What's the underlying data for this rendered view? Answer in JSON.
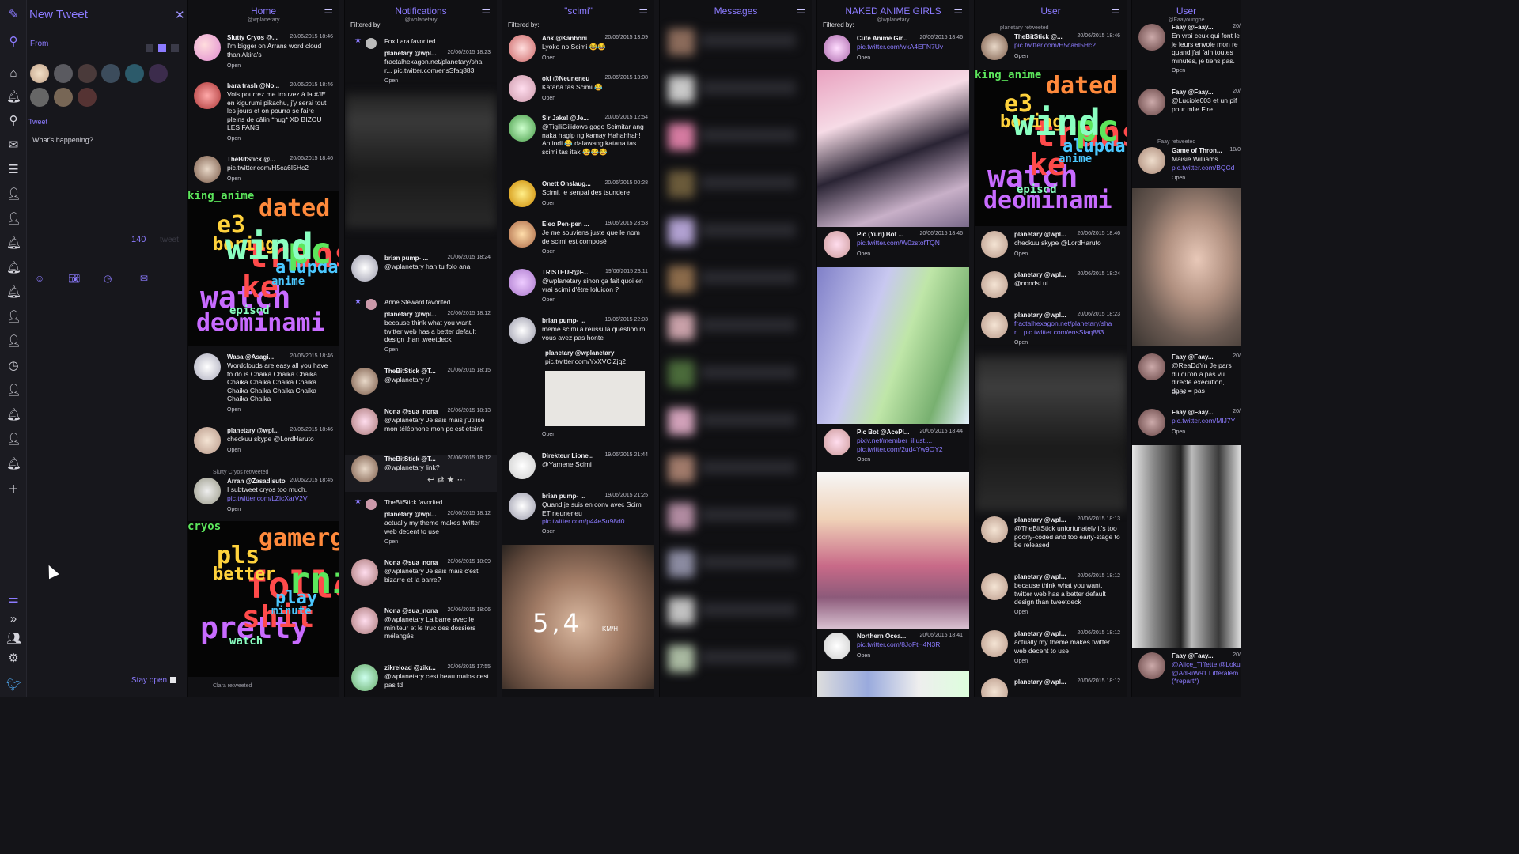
{
  "compose": {
    "title": "New Tweet",
    "from_label": "From",
    "tweet_label": "Tweet",
    "placeholder": "What's happening?",
    "char_count": "140",
    "char_label": "tweet",
    "stay_open": "Stay open"
  },
  "columns": [
    {
      "id": "home",
      "title": "Home",
      "subtitle": "@wplanetary"
    },
    {
      "id": "notifications",
      "title": "Notifications",
      "filter": "Filtered by:",
      "subtitle": "@wplanetary"
    },
    {
      "id": "scimi",
      "title": "\"scimi\"",
      "filter": "Filtered by:",
      "subtitle": "@wplanetary"
    },
    {
      "id": "messages",
      "title": "Messages"
    },
    {
      "id": "naked",
      "title": "NAKED ANIME GIRLS",
      "filter": "Filtered by:",
      "subtitle": "@wplanetary"
    },
    {
      "id": "user1",
      "title": "User",
      "subtitle": "@wplanetary"
    },
    {
      "id": "user2",
      "title": "User",
      "subtitle": "@Faayounghe"
    }
  ],
  "home": [
    {
      "name": "Slutty Cryos @...",
      "time": "20/06/2015 18:46",
      "text": "I'm bigger on Arrans word cloud than Akira's",
      "open": "Open"
    },
    {
      "name": "bara trash @No...",
      "time": "20/06/2015 18:46",
      "text": "Vois pourrez me trouvez à la #JE en kigurumi pikachu, j'y serai tout les jours et on pourra se faire pleins de câlin *hug* XD BIZOU LES FANS",
      "open": "Open"
    },
    {
      "name": "TheBitStick @...",
      "time": "20/06/2015 18:46",
      "text": "pic.twitter.com/H5ca6I5Hc2",
      "open": "Open"
    },
    {
      "name": "Wasa @Asagi...",
      "time": "20/06/2015 18:46",
      "text": "Wordclouds are easy all you have to do is Chaika Chaika Chaika Chaika Chaika Chaika Chaika Chaika Chaika Chaika Chaika Chaika Chaika",
      "open": "Open"
    },
    {
      "name": "planetary @wpl...",
      "time": "20/06/2015 18:46",
      "text": "checkuu skype @LordHaruto",
      "open": "Open"
    },
    {
      "retweet": "Slutty Cryos retweeted",
      "name": "Arran @Zasadisuto",
      "time": "20/06/2015 18:45",
      "text": "I subtweet cryos too much.",
      "link": "pic.twitter.com/LZicXarV2V",
      "open": "Open"
    },
    {
      "retweet": "Clara retweeted"
    }
  ],
  "notifications": [
    {
      "fav": "Fox Lara favorited",
      "name": "planetary @wpl...",
      "time": "20/06/2015 18:23",
      "text": "fractalhexagon.net/planetary/sha r... pic.twitter.com/ensSfaq883",
      "open": "Open"
    },
    {
      "name": "brian pump- ...",
      "time": "20/06/2015 18:24",
      "text": "@wplanetary han tu folo ana"
    },
    {
      "fav": "Anne Steward favorited",
      "name": "planetary @wpl...",
      "time": "20/06/2015 18:12",
      "text": "because think what you want, twitter web has a better default design than tweetdeck",
      "open": "Open"
    },
    {
      "name": "TheBitStick @T...",
      "time": "20/06/2015 18:15",
      "text": "@wplanetary :/"
    },
    {
      "name": "Nona @sua_nona",
      "time": "20/06/2015 18:13",
      "text": "@wplanetary Je sais mais j'utilise mon téléphone mon pc est eteint"
    },
    {
      "name": "TheBitStick @T...",
      "time": "20/06/2015 18:12",
      "text": "@wplanetary link?"
    },
    {
      "fav": "TheBitStick favorited",
      "name": "planetary @wpl...",
      "time": "20/06/2015 18:12",
      "text": "actually my theme makes twitter web decent to use",
      "open": "Open"
    },
    {
      "name": "Nona @sua_nona",
      "time": "20/06/2015 18:09",
      "text": "@wplanetary Je sais mais c'est bizarre et la barre?"
    },
    {
      "name": "Nona @sua_nona",
      "time": "20/06/2015 18:06",
      "text": "@wplanetary La barre avec le miniteur et le truc des dossiers mélangés"
    },
    {
      "name": "zikreload @zikr...",
      "time": "20/06/2015 17:55",
      "text": "@wplanetary cest beau maios cest pas td"
    }
  ],
  "scimi": [
    {
      "name": "Ank @Kanboni",
      "time": "20/06/2015 13:09",
      "text": "Lyoko no Scimi 😂😂",
      "open": "Open"
    },
    {
      "name": "oki @Neuneneu",
      "time": "20/06/2015 13:08",
      "text": "Katana tas Scimi 😂",
      "open": "Open"
    },
    {
      "name": "Sir Jake! @Je...",
      "time": "20/06/2015 12:54",
      "text": "@TigiliGilidows gago Scimitar ang naka hagip ng kamay Hahahhah! Antindi 😂 dalawang katana tas scimi tas itak 😂😂😂"
    },
    {
      "name": "Onett Onslaug...",
      "time": "20/06/2015 00:28",
      "text": "Scimi, le senpai des tsundere",
      "open": "Open"
    },
    {
      "name": "Eleo Pen-pen ...",
      "time": "19/06/2015 23:53",
      "text": "Je me souviens juste que le nom de scimi est composé",
      "open": "Open"
    },
    {
      "name": "TRISTEUR@F...",
      "time": "19/06/2015 23:11",
      "text": "@wplanetary sinon ça fait quoi en vrai scimi d'être loluicon ?",
      "open": "Open"
    },
    {
      "name": "brian pump- ...",
      "time": "19/06/2015 22:03",
      "text": "meme scimi a reussi la question m vous avez pas honte"
    },
    {
      "name": "planetary @wplanetary",
      "text": "pic.twitter.com/YxXVClZjq2",
      "open": "Open"
    },
    {
      "name": "Direkteur Lione...",
      "time": "19/06/2015 21:44",
      "text": "@Yamene Scimi"
    },
    {
      "name": "brian pump- ...",
      "time": "19/06/2015 21:25",
      "text": "Quand je suis en conv avec Scimi ET neuneneu",
      "link": "pic.twitter.com/p44eSu98d0",
      "open": "Open"
    },
    {
      "speed": "5,4",
      "unit": "KM/H"
    }
  ],
  "naked": [
    {
      "name": "Cute Anime Gir...",
      "time": "20/06/2015 18:46",
      "text": "pic.twitter.com/wkA4EFN7Uv",
      "open": "Open"
    },
    {
      "name": "Pic (Yuri) Bot ...",
      "time": "20/06/2015 18:46",
      "text": "pic.twitter.com/W0zstofTQN",
      "open": "Open"
    },
    {
      "name": "Pic Bot @AcePi...",
      "time": "20/06/2015 18:44",
      "text": "pixiv.net/member_illust.... pic.twitter.com/2ud4Yw9OY2",
      "open": "Open"
    },
    {
      "name": "Northern Ocea...",
      "time": "20/06/2015 18:41",
      "text": "pic.twitter.com/8JoFtH4N3R",
      "open": "Open"
    }
  ],
  "user1": [
    {
      "retweet": "planetary retweeted",
      "name": "TheBitStick @...",
      "time": "20/06/2015 18:46",
      "text": "pic.twitter.com/H5ca6I5Hc2",
      "open": "Open"
    },
    {
      "name": "planetary @wpl...",
      "time": "20/06/2015 18:46",
      "text": "checkuu skype @LordHaruto",
      "open": "Open"
    },
    {
      "name": "planetary @wpl...",
      "time": "20/06/2015 18:24",
      "text": "@nondsl ui"
    },
    {
      "name": "planetary @wpl...",
      "time": "20/06/2015 18:23",
      "text": "fractalhexagon.net/planetary/sha r... pic.twitter.com/ensSfaq883",
      "open": "Open"
    },
    {
      "name": "planetary @wpl...",
      "time": "20/06/2015 18:13",
      "text": "@TheBitStick unfortunately it's too poorly-coded and too early-stage to be released"
    },
    {
      "name": "planetary @wpl...",
      "time": "20/06/2015 18:12",
      "text": "because think what you want, twitter web has a better default design than tweetdeck",
      "open": "Open"
    },
    {
      "name": "planetary @wpl...",
      "time": "20/06/2015 18:12",
      "text": "actually my theme makes twitter web decent to use",
      "open": "Open"
    },
    {
      "name": "planetary @wpl...",
      "time": "20/06/2015 18:12"
    }
  ],
  "user2": [
    {
      "name": "Faay @Faay...",
      "time": "20/",
      "text": "En vrai ceux qui font le je leurs envoie mon re quand j'ai fain toutes minutes, je tiens pas.",
      "open": "Open"
    },
    {
      "name": "Faay @Faay...",
      "time": "20/",
      "text": "@Luciole003 et un pif pour mlle Fire"
    },
    {
      "retweet": "Faay retweeted",
      "name": "Game of Thron...",
      "time": "18/0",
      "text": "Maisie Williams",
      "link": "pic.twitter.com/BQCd",
      "open": "Open"
    },
    {
      "name": "Faay @Faay...",
      "time": "20/",
      "text": "@ReaDdYn Je pars du qu'on a pas vu directe exécution, donc = pas",
      "open": "Open"
    },
    {
      "name": "Faay @Faay...",
      "time": "20/",
      "text": "pic.twitter.com/MIJ7Y",
      "open": "Open"
    },
    {
      "name": "Faay @Faay...",
      "time": "20/",
      "text": "@Alice_Tiffette @Loku @AdRiW91 Littéralem (*repart*)"
    }
  ],
  "wordcloud1": [
    "king_anime",
    "e3",
    "translator",
    "alupdate",
    "watch",
    "episod",
    "dated",
    "pc",
    "boring",
    "ke",
    "anime",
    "deominami",
    "wind"
  ],
  "wordcloud2": [
    "cryos",
    "pls",
    "follow",
    "play",
    "pretty",
    "watch",
    "gamergate",
    "rning",
    "better",
    "shit",
    "minute"
  ],
  "colors": {
    "accent": "#8c7bff",
    "bg": "#101013",
    "panel": "#17171c"
  }
}
